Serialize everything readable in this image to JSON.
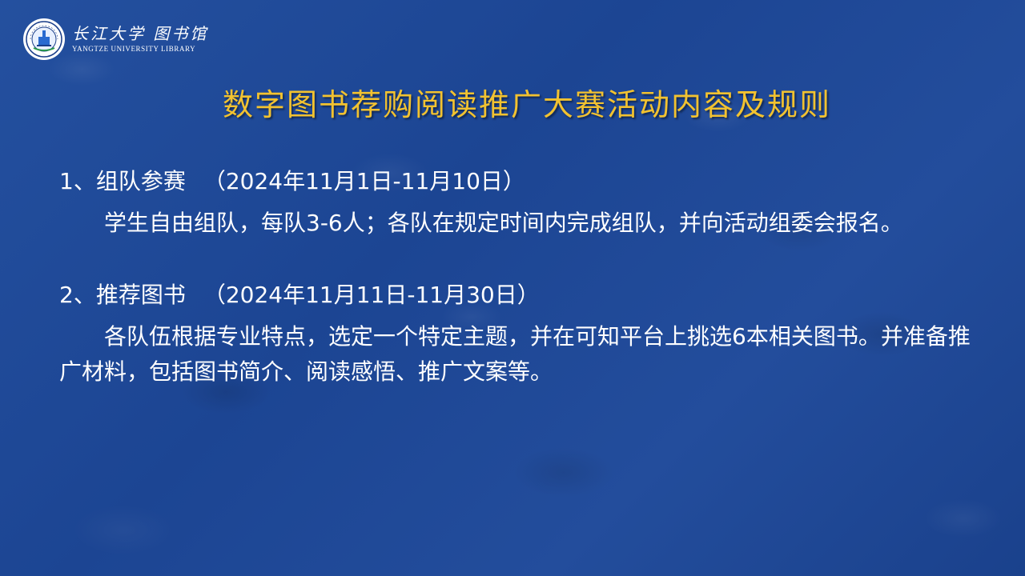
{
  "header": {
    "logo_cn": "长江大学 图书馆",
    "logo_en": "YANGTZE UNIVERSITY LIBRARY"
  },
  "title": "数字图书荐购阅读推广大赛活动内容及规则",
  "sections": [
    {
      "heading": "1、组队参赛",
      "date": "（2024年11月1日-11月10日）",
      "body": "学生自由组队，每队3-6人；各队在规定时间内完成组队，并向活动组委会报名。"
    },
    {
      "heading": "2、推荐图书",
      "date": "（2024年11月11日-11月30日）",
      "body": "各队伍根据专业特点，选定一个特定主题，并在可知平台上挑选6本相关图书。并准备推广材料，包括图书简介、阅读感悟、推广文案等。"
    }
  ],
  "colors": {
    "background": "#1f4a9a",
    "title": "#f2c230",
    "text": "#ffffff"
  }
}
